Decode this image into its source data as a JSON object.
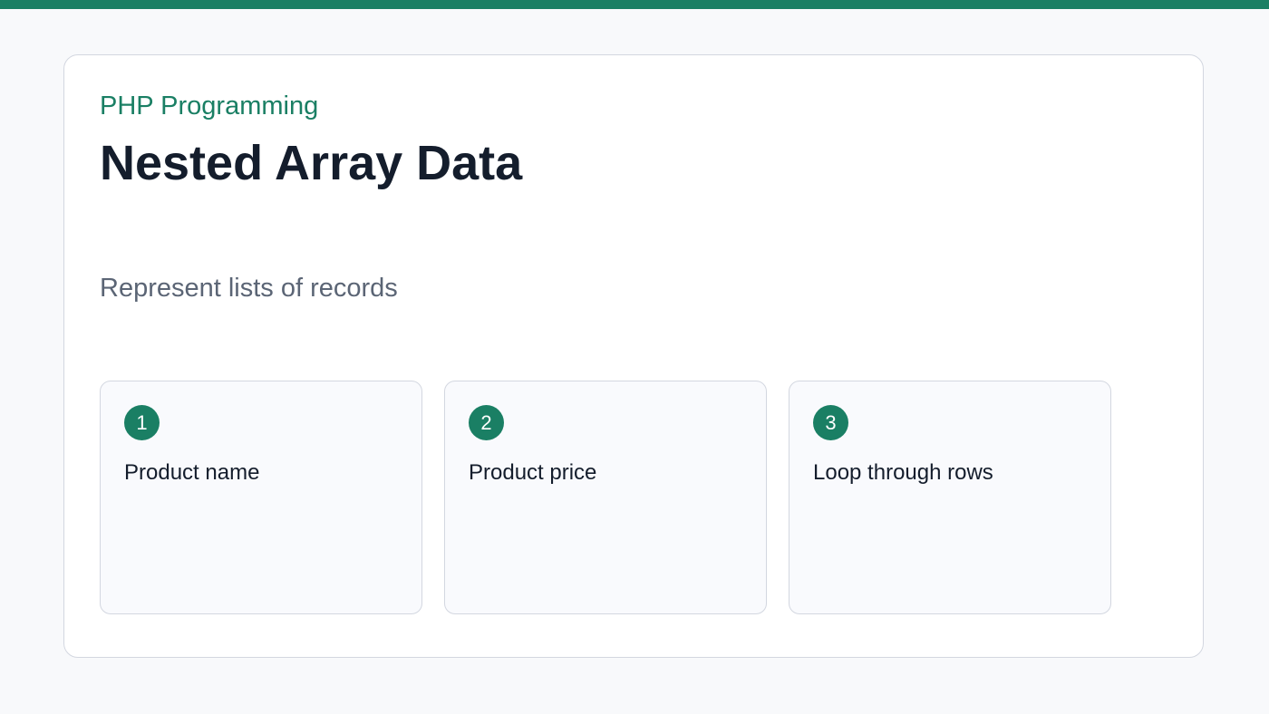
{
  "colors": {
    "accent": "#1a7f64",
    "title": "#141d2c",
    "subtitle": "#5b6575",
    "background": "#f8f9fb",
    "border": "#d3d7e0"
  },
  "header": {
    "eyebrow": "PHP Programming",
    "title": "Nested Array Data",
    "subtitle": "Represent lists of records"
  },
  "steps": [
    {
      "number": "1",
      "label": "Product name"
    },
    {
      "number": "2",
      "label": "Product price"
    },
    {
      "number": "3",
      "label": "Loop through rows"
    }
  ]
}
